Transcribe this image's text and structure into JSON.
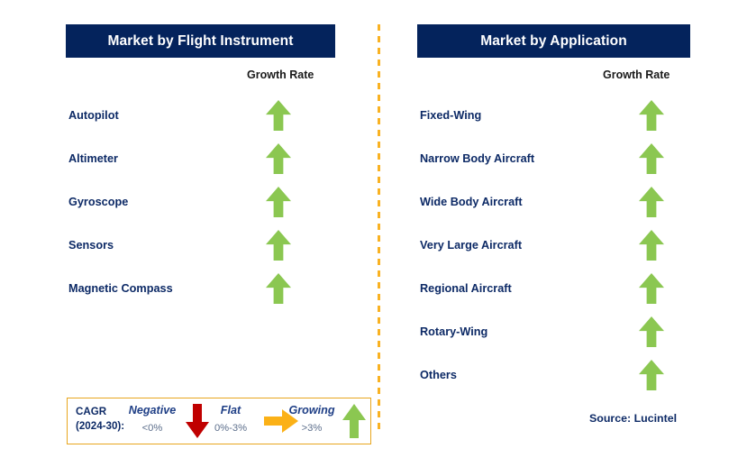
{
  "panels": [
    {
      "id": "flight-instrument",
      "title": "Market by Flight Instrument",
      "growth_rate_label": "Growth Rate",
      "items": [
        {
          "label": "Autopilot",
          "trend": "growing"
        },
        {
          "label": "Altimeter",
          "trend": "growing"
        },
        {
          "label": "Gyroscope",
          "trend": "growing"
        },
        {
          "label": "Sensors",
          "trend": "growing"
        },
        {
          "label": "Magnetic Compass",
          "trend": "growing"
        }
      ]
    },
    {
      "id": "application",
      "title": "Market by Application",
      "growth_rate_label": "Growth Rate",
      "items": [
        {
          "label": "Fixed-Wing",
          "trend": "growing"
        },
        {
          "label": "Narrow Body Aircraft",
          "trend": "growing"
        },
        {
          "label": "Wide Body Aircraft",
          "trend": "growing"
        },
        {
          "label": "Very Large Aircraft",
          "trend": "growing"
        },
        {
          "label": "Regional Aircraft",
          "trend": "growing"
        },
        {
          "label": "Rotary-Wing",
          "trend": "growing"
        },
        {
          "label": "Others",
          "trend": "growing"
        }
      ]
    }
  ],
  "legend": {
    "title_line1": "CAGR",
    "title_line2": "(2024-30):",
    "entries": [
      {
        "name": "Negative",
        "range": "<0%",
        "icon": "arrow-down-icon",
        "color": "#c00000"
      },
      {
        "name": "Flat",
        "range": "0%-3%",
        "icon": "arrow-right-icon",
        "color": "#fbb117"
      },
      {
        "name": "Growing",
        "range": ">3%",
        "icon": "arrow-up-icon",
        "color": "#8bc751"
      }
    ]
  },
  "source": "Source: Lucintel",
  "colors": {
    "header_navy": "#04235c",
    "label_navy": "#0d2a66",
    "growing_green": "#8bc751",
    "negative_red": "#c00000",
    "flat_orange": "#fbb117",
    "divider_orange": "#f9b222",
    "legend_border": "#e8a61e"
  }
}
